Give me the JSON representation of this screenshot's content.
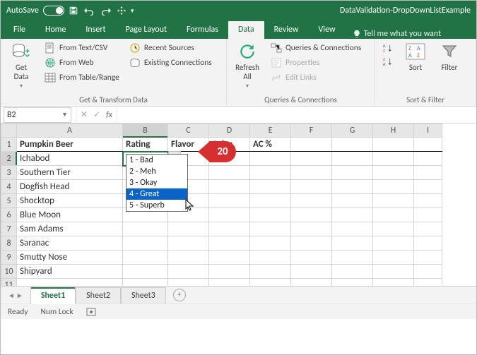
{
  "titlebar": {
    "autosave": "AutoSave",
    "doc_title": "DataValidation-DropDownListExample"
  },
  "tabs": {
    "file": "File",
    "home": "Home",
    "insert": "Insert",
    "pagelayout": "Page Layout",
    "formulas": "Formulas",
    "data": "Data",
    "review": "Review",
    "view": "View",
    "tellme": "Tell me what you want"
  },
  "ribbon": {
    "getdata": "Get\nData",
    "fromtextcsv": "From Text/CSV",
    "fromweb": "From Web",
    "fromtable": "From Table/Range",
    "recent": "Recent Sources",
    "existing": "Existing Connections",
    "group1": "Get & Transform Data",
    "refresh": "Refresh\nAll",
    "queries": "Queries & Connections",
    "properties": "Properties",
    "editlinks": "Edit Links",
    "group2": "Queries & Connections",
    "sort": "Sort",
    "filter": "Filter",
    "group3": "Sort & Filter"
  },
  "namebox": "B2",
  "headers": {
    "A": "A",
    "B": "B",
    "C": "C",
    "D": "D",
    "E": "E",
    "F": "F",
    "G": "G",
    "H": "H",
    "I": "I"
  },
  "row1": {
    "A": "Pumpkin Beer",
    "B": "Rating",
    "C": "Flavor",
    "D": "Color",
    "E": "AC %"
  },
  "rows": {
    "2": "Ichabod",
    "3": "Southern Tier",
    "4": "Dogfish Head",
    "5": "Shocktop",
    "6": "Blue Moon",
    "7": "Sam Adams",
    "8": "Saranac",
    "9": "Smutty Nose",
    "10": "Shipyard"
  },
  "dv": {
    "1": "1 - Bad",
    "2": "2 - Meh",
    "3": "3 - Okay",
    "4": "4 - Great",
    "5": "5 - Superb"
  },
  "callout": "20",
  "sheets": {
    "s1": "Sheet1",
    "s2": "Sheet2",
    "s3": "Sheet3"
  },
  "status": {
    "ready": "Ready",
    "numlock": "Num Lock"
  }
}
